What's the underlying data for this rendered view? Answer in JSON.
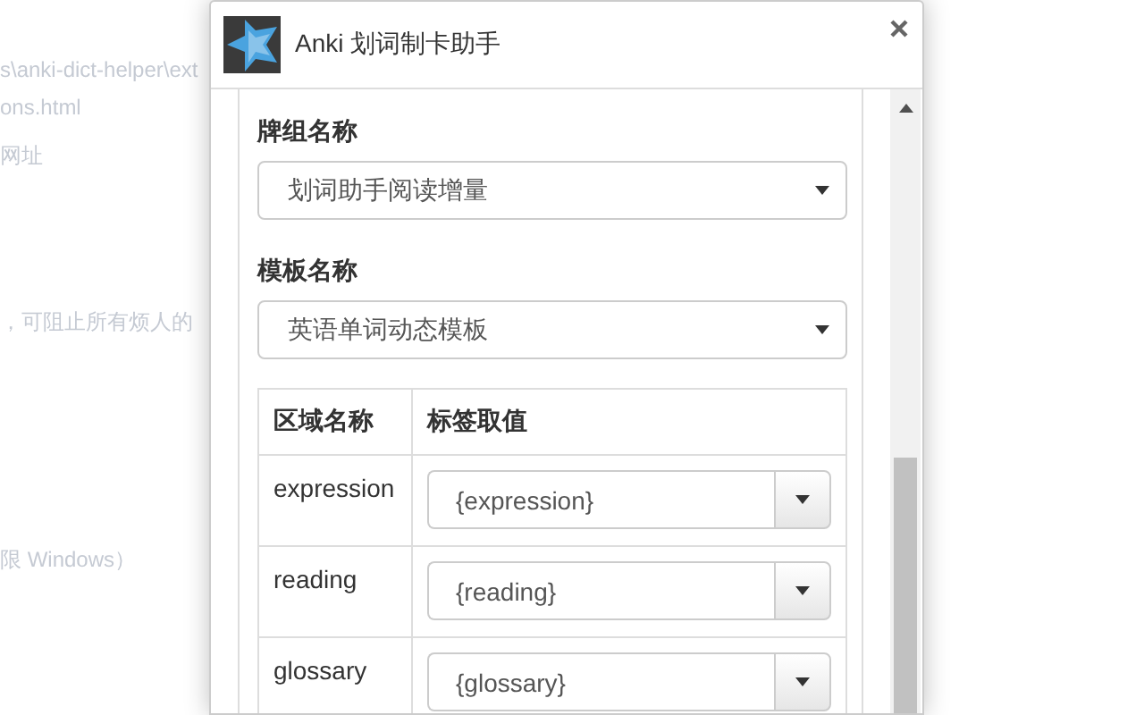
{
  "background_page": {
    "lines": [
      "s\\anki-dict-helper\\ext",
      "ons.html",
      "网址",
      "，可阻止所有烦人的",
      "限 Windows）"
    ]
  },
  "popup": {
    "title": "Anki 划词制卡助手",
    "fields": [
      {
        "label": "牌组名称",
        "value": "划词助手阅读增量"
      },
      {
        "label": "模板名称",
        "value": "英语单词动态模板"
      }
    ],
    "table": {
      "columns": [
        "区域名称",
        "标签取值"
      ],
      "rows": [
        {
          "field": "expression",
          "value": "{expression}"
        },
        {
          "field": "reading",
          "value": "{reading}"
        },
        {
          "field": "glossary",
          "value": "{glossary}"
        }
      ]
    }
  }
}
